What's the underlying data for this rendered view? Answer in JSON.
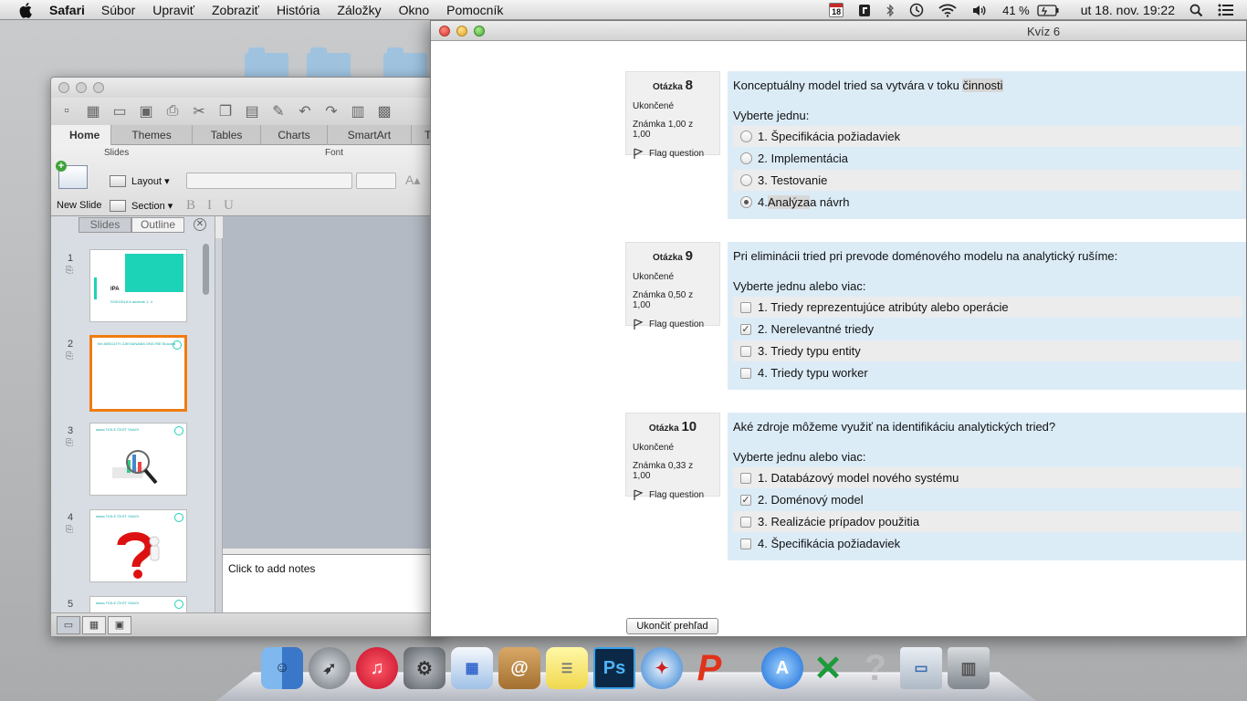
{
  "menubar": {
    "app_name": "Safari",
    "items": [
      "Súbor",
      "Upraviť",
      "Zobraziť",
      "História",
      "Záložky",
      "Okno",
      "Pomocník"
    ],
    "calendar_day": "18",
    "battery": "41 %",
    "clock": "ut 18. nov.  19:22"
  },
  "ppt": {
    "tabs": [
      "Home",
      "Themes",
      "Tables",
      "Charts",
      "SmartArt",
      "Tr"
    ],
    "ribbon": {
      "slides_group": "Slides",
      "font_group": "Font",
      "new_slide": "New Slide",
      "layout": "Layout",
      "section": "Section"
    },
    "panel_tabs": [
      "Slides",
      "Outline"
    ],
    "slides": [
      {
        "num": "1",
        "title": "IPA",
        "subtitle": "DOKODLA 6 andenie 1. 4"
      },
      {
        "num": "2",
        "title": "Ihe ABSOLTIY ZJIKSANAMA ONG RIE Elocana"
      },
      {
        "num": "3",
        "title": "aiasa TIOLE ČKST YAAOI"
      },
      {
        "num": "4",
        "title": "aiasa TIOLE ČKST YAAOI"
      },
      {
        "num": "5",
        "title": "aiasa TIOLE ČKST YAAOI"
      }
    ],
    "notes_placeholder": "Click to add notes"
  },
  "safari": {
    "title": "Kvíz 6",
    "questions": [
      {
        "label": "Otázka",
        "number": "8",
        "status": "Ukončené",
        "grade": "Známka 1,00 z 1,00",
        "flag": "Flag question",
        "text_pre": "Konceptuálny model tried sa vytvára v toku ",
        "text_hl": "činnosti",
        "prompt": "Vyberte jednu:",
        "type": "radio",
        "answers": [
          {
            "pre": "1. Špecifikácia požiadaviek",
            "hl": "",
            "post": "",
            "checked": false
          },
          {
            "pre": "2. Implementácia",
            "hl": "",
            "post": "",
            "checked": false
          },
          {
            "pre": "3. Testovanie",
            "hl": "",
            "post": "",
            "checked": false
          },
          {
            "pre": "4. ",
            "hl": "Analýza",
            "post": " a návrh",
            "checked": true
          }
        ]
      },
      {
        "label": "Otázka",
        "number": "9",
        "status": "Ukončené",
        "grade": "Známka 0,50 z 1,00",
        "flag": "Flag question",
        "text_pre": "Pri eliminácii tried pri prevode doménového modelu na analytický rušíme:",
        "text_hl": "",
        "prompt": "Vyberte jednu alebo viac:",
        "type": "checkbox",
        "answers": [
          {
            "pre": "1. Triedy reprezentujúce atribúty alebo operácie",
            "hl": "",
            "post": "",
            "checked": false
          },
          {
            "pre": "2. Nerelevantné triedy",
            "hl": "",
            "post": "",
            "checked": true
          },
          {
            "pre": "3. Triedy typu entity",
            "hl": "",
            "post": "",
            "checked": false
          },
          {
            "pre": "4. Triedy typu worker",
            "hl": "",
            "post": "",
            "checked": false
          }
        ]
      },
      {
        "label": "Otázka",
        "number": "10",
        "status": "Ukončené",
        "grade": "Známka 0,33 z 1,00",
        "flag": "Flag question",
        "text_pre": "Aké zdroje môžeme využiť na identifikáciu analytických tried?",
        "text_hl": "",
        "prompt": "Vyberte jednu alebo viac:",
        "type": "checkbox",
        "answers": [
          {
            "pre": "1. Databázový model nového systému",
            "hl": "",
            "post": "",
            "checked": false
          },
          {
            "pre": "2. Doménový model",
            "hl": "",
            "post": "",
            "checked": true
          },
          {
            "pre": "3. Realizácie prípadov použitia",
            "hl": "",
            "post": "",
            "checked": false
          },
          {
            "pre": "4. Špecifikácia požiadaviek",
            "hl": "",
            "post": "",
            "checked": false
          }
        ]
      }
    ],
    "finish_button": "Ukončiť prehľad"
  },
  "dock": {
    "apps": [
      "finder-icon",
      "launchpad-icon",
      "itunes-icon",
      "system-preferences-icon",
      "preview-icon",
      "contacts-icon",
      "stickies-icon",
      "photoshop-icon",
      "safari-icon",
      "powerpoint-icon",
      "app-store-icon",
      "excel-icon",
      "help-icon",
      "screen-sharing-icon",
      "trash-icon"
    ],
    "ps_label": "Ps"
  },
  "colors": {
    "question_bg": "#dcecf7",
    "info_bg": "#f0f0f0",
    "teal_accent": "#1dd3b7",
    "selection_orange": "#f07c10"
  }
}
